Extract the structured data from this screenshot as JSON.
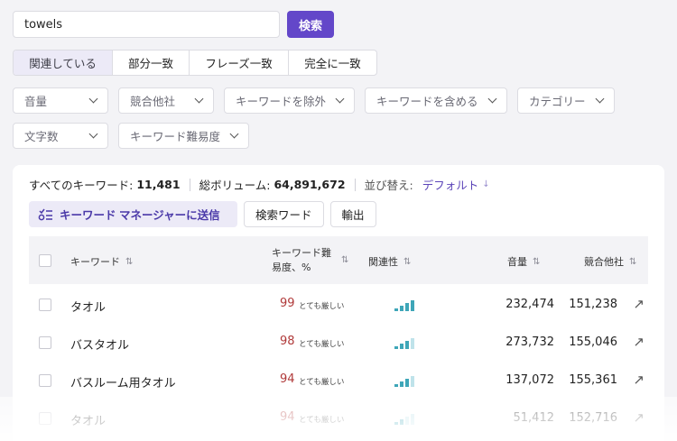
{
  "search": {
    "value": "towels",
    "button_label": "検索"
  },
  "match_tabs": [
    {
      "label": "関連している",
      "active": true
    },
    {
      "label": "部分一致"
    },
    {
      "label": "フレーズ一致"
    },
    {
      "label": "完全に一致"
    }
  ],
  "filters": {
    "volume": "音量",
    "competitors": "競合他社",
    "exclude": "キーワードを除外",
    "include": "キーワードを含める",
    "category": "カテゴリー",
    "char_count": "文字数",
    "difficulty": "キーワード難易度"
  },
  "summary": {
    "all_keywords_label": "すべてのキーワード:",
    "all_keywords_value": "11,481",
    "total_volume_label": "総ボリューム:",
    "total_volume_value": "64,891,672",
    "sort_label": "並び替え:",
    "sort_value": "デフォルト",
    "sort_arrow": "↓"
  },
  "actions": {
    "send_label": "キーワード マネージャーに送信",
    "search_words_label": "検索ワード",
    "export_label": "輸出"
  },
  "table": {
    "headers": {
      "keyword": "キーワード",
      "difficulty_line1": "キーワード難",
      "difficulty_line2": "易度、%",
      "relevance": "関連性",
      "volume": "音量",
      "competitors": "競合他社",
      "sort_icon": "⇅"
    },
    "rows": [
      {
        "keyword": "タオル",
        "difficulty": "99",
        "difficulty_label": "とても厳しい",
        "relevance_bars": 4,
        "volume": "232,474",
        "competitors": "151,238"
      },
      {
        "keyword": "バスタオル",
        "difficulty": "98",
        "difficulty_label": "とても厳しい",
        "relevance_bars": 3,
        "volume": "273,732",
        "competitors": "155,046"
      },
      {
        "keyword": "バスルーム用タオル",
        "difficulty": "94",
        "difficulty_label": "とても厳しい",
        "relevance_bars": 3,
        "volume": "137,072",
        "competitors": "155,361"
      },
      {
        "keyword": "タオル",
        "difficulty": "94",
        "difficulty_label": "とても厳しい",
        "relevance_bars": 2,
        "volume": "51,412",
        "competitors": "152,716"
      }
    ]
  },
  "colors": {
    "accent": "#6347c9",
    "difficulty": "#b03a3a",
    "relevance": "#3ea6b8"
  }
}
